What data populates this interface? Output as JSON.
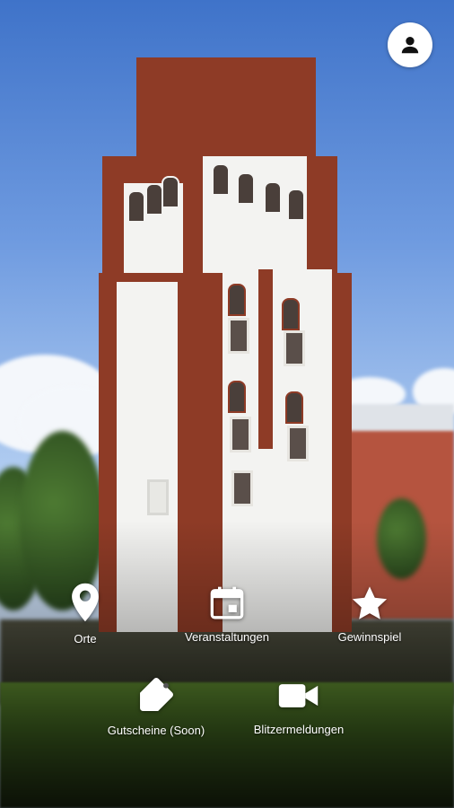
{
  "header": {
    "profile_icon": "person-icon"
  },
  "menu": {
    "items": [
      {
        "label": "Orte",
        "icon": "map-pin-icon"
      },
      {
        "label": "Veranstaltungen",
        "icon": "calendar-icon"
      },
      {
        "label": "Gewinnspiel",
        "icon": "star-icon"
      },
      {
        "label": "Gutscheine (Soon)",
        "icon": "tag-icon"
      },
      {
        "label": "Blitzermeldungen",
        "icon": "video-camera-icon"
      }
    ]
  },
  "colors": {
    "accent": "#ffffff",
    "sky": "#5b8bd9",
    "brick": "#8e3b26"
  }
}
